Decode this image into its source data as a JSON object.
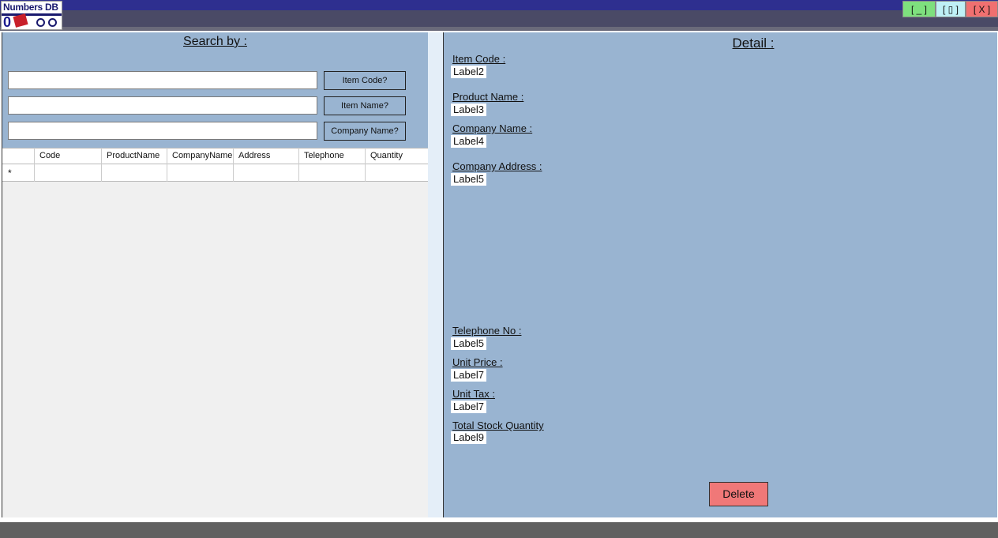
{
  "window": {
    "logo_text": "Numbers DB",
    "logo_digit": "0",
    "minimize_label": "[ _ ]",
    "maximize_label": "[ ▯ ]",
    "close_label": "[ X ]"
  },
  "search": {
    "title": "Search by :",
    "item_code_value": "",
    "item_name_value": "",
    "company_name_value": "",
    "item_code_button": "Item Code?",
    "item_name_button": "Item Name?",
    "company_name_button": "Company Name?"
  },
  "grid": {
    "columns": [
      "Code",
      "ProductName",
      "CompanyName",
      "Address",
      "Telephone",
      "Quantity"
    ],
    "new_row_marker": "*"
  },
  "detail": {
    "title": "Detail :",
    "item_code_label": "Item Code :",
    "item_code_value": "Label2",
    "product_name_label": "Product Name :",
    "product_name_value": "Label3",
    "company_name_label": "Company Name :",
    "company_name_value": "Label4",
    "company_address_label": "Company Address :",
    "company_address_value": "Label5",
    "telephone_label": "Telephone No :",
    "telephone_value": "Label5",
    "unit_price_label": "Unit Price :",
    "unit_price_value": "Label7",
    "unit_tax_label": "Unit Tax :",
    "unit_tax_value": "Label7",
    "total_stock_label": "Total Stock Quantity",
    "total_stock_value": "Label9",
    "delete_button": "Delete"
  }
}
